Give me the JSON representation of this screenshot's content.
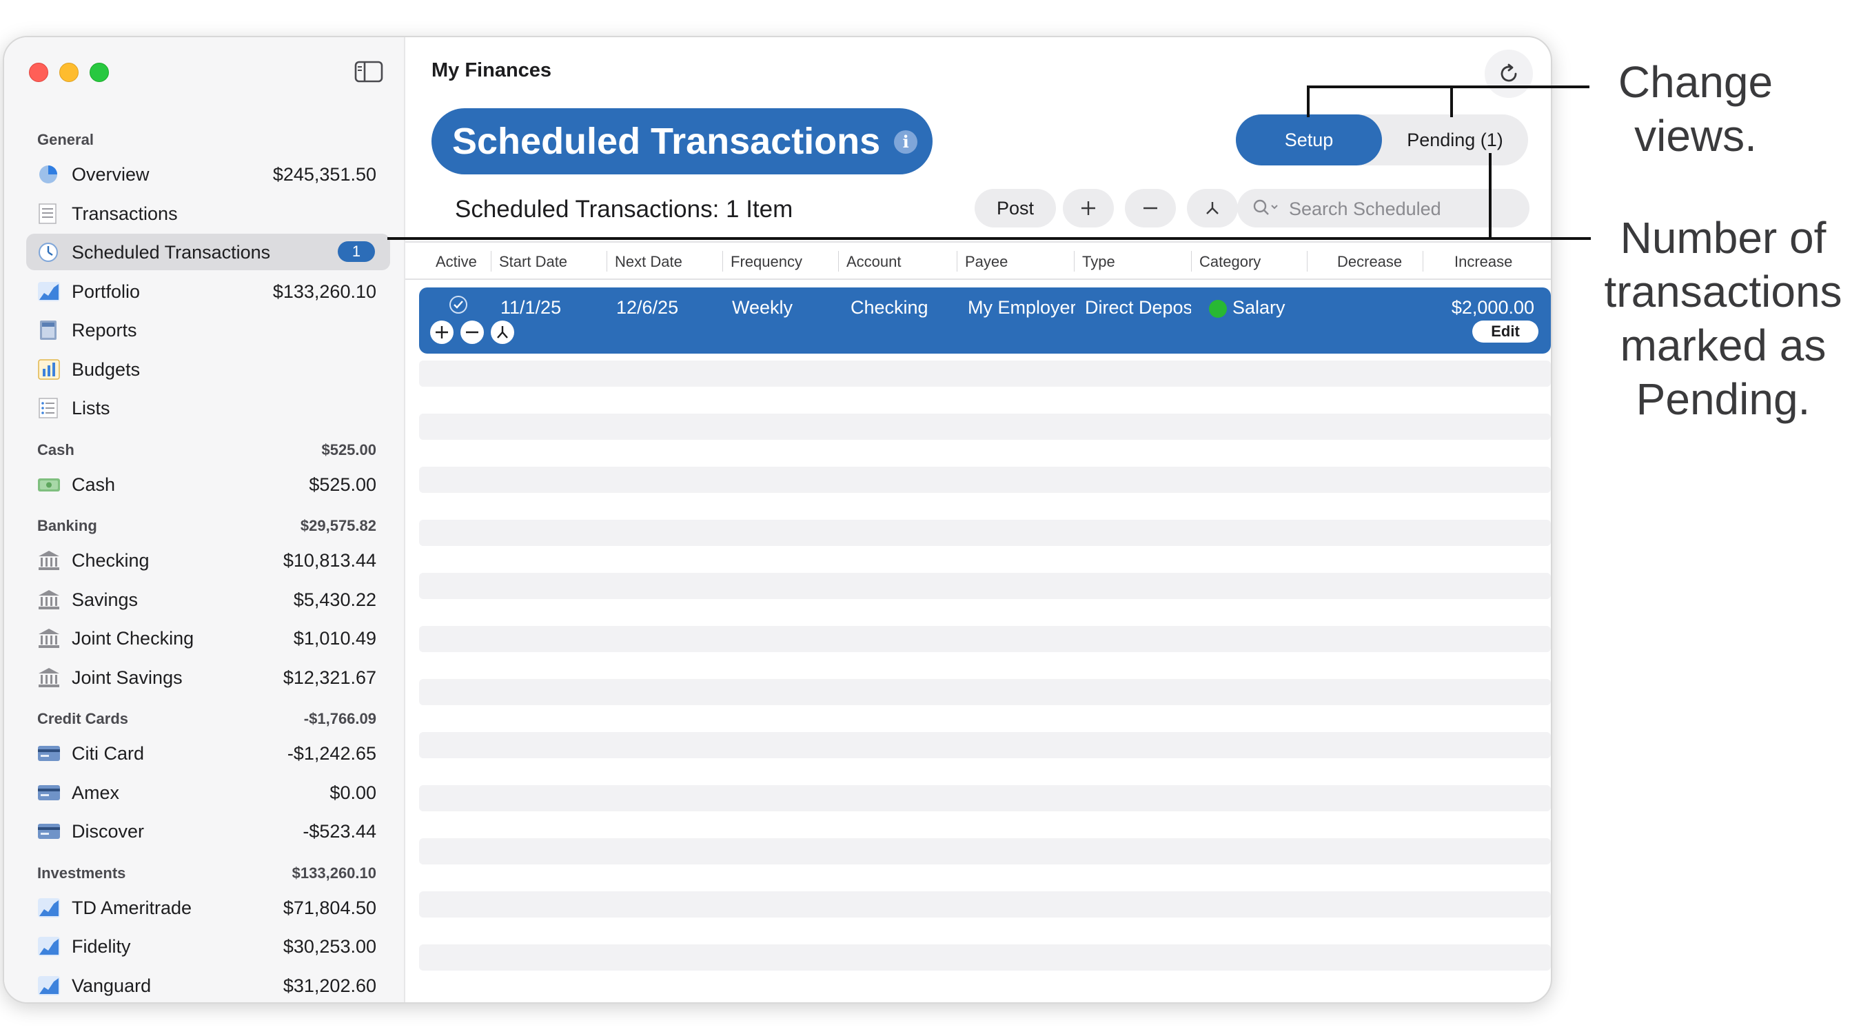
{
  "sidebar": {
    "sections": [
      {
        "label": "General",
        "total": "",
        "items": [
          {
            "label": "Overview",
            "amount": "$245,351.50",
            "icon": "pie-chart-icon"
          },
          {
            "label": "Transactions",
            "amount": "",
            "icon": "ledger-icon"
          },
          {
            "label": "Scheduled Transactions",
            "badge": "1",
            "icon": "clock-icon",
            "selected": true
          },
          {
            "label": "Portfolio",
            "amount": "$133,260.10",
            "icon": "stock-chart-icon"
          },
          {
            "label": "Reports",
            "amount": "",
            "icon": "reports-icon"
          },
          {
            "label": "Budgets",
            "amount": "",
            "icon": "budget-chart-icon"
          },
          {
            "label": "Lists",
            "amount": "",
            "icon": "list-icon"
          }
        ]
      },
      {
        "label": "Cash",
        "total": "$525.00",
        "items": [
          {
            "label": "Cash",
            "amount": "$525.00",
            "icon": "cash-icon"
          }
        ]
      },
      {
        "label": "Banking",
        "total": "$29,575.82",
        "items": [
          {
            "label": "Checking",
            "amount": "$10,813.44",
            "icon": "bank-icon"
          },
          {
            "label": "Savings",
            "amount": "$5,430.22",
            "icon": "bank-icon"
          },
          {
            "label": "Joint Checking",
            "amount": "$1,010.49",
            "icon": "bank-icon"
          },
          {
            "label": "Joint Savings",
            "amount": "$12,321.67",
            "icon": "bank-icon"
          }
        ]
      },
      {
        "label": "Credit Cards",
        "total": "-$1,766.09",
        "items": [
          {
            "label": "Citi Card",
            "amount": "-$1,242.65",
            "icon": "credit-card-icon"
          },
          {
            "label": "Amex",
            "amount": "$0.00",
            "icon": "credit-card-icon"
          },
          {
            "label": "Discover",
            "amount": "-$523.44",
            "icon": "credit-card-icon"
          }
        ]
      },
      {
        "label": "Investments",
        "total": "$133,260.10",
        "items": [
          {
            "label": "TD Ameritrade",
            "amount": "$71,804.50",
            "icon": "stock-chart-icon"
          },
          {
            "label": "Fidelity",
            "amount": "$30,253.00",
            "icon": "stock-chart-icon"
          },
          {
            "label": "Vanguard",
            "amount": "$31,202.60",
            "icon": "stock-chart-icon"
          }
        ]
      }
    ]
  },
  "header": {
    "doc_title": "My Finances",
    "page_title": "Scheduled Transactions",
    "view_setup": "Setup",
    "view_pending": "Pending (1)"
  },
  "toolbar": {
    "count_label": "Scheduled Transactions: 1 Item",
    "post_label": "Post",
    "search_placeholder": "Search Scheduled"
  },
  "table": {
    "columns": [
      "Active",
      "Start Date",
      "Next Date",
      "Frequency",
      "Account",
      "Payee",
      "Type",
      "Category",
      "Decrease",
      "Increase"
    ],
    "rows": [
      {
        "start_date": "11/1/25",
        "next_date": "12/6/25",
        "frequency": "Weekly",
        "account": "Checking",
        "payee": "My Employer",
        "type": "Direct Deposit",
        "category": "Salary",
        "decrease": "",
        "increase": "$2,000.00",
        "edit_label": "Edit"
      }
    ]
  },
  "callouts": {
    "views": "Change views.",
    "pending": "Number of transactions marked as Pending."
  },
  "colors": {
    "accent": "#2c6db8",
    "category_dot": "#28b833"
  }
}
